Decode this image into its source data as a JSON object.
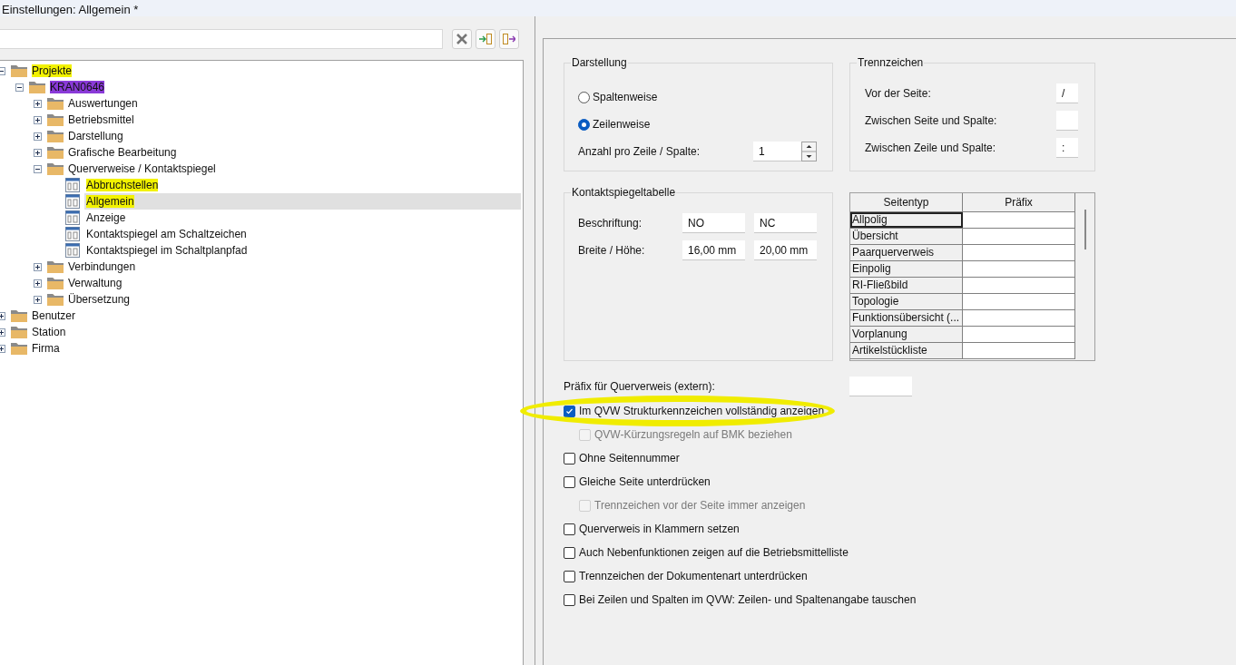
{
  "window": {
    "title": "Einstellungen: Allgemein *"
  },
  "toolbar": [
    {
      "kind": "clear"
    },
    {
      "kind": "import"
    },
    {
      "kind": "export"
    }
  ],
  "tree": [
    {
      "label": "Projekte",
      "kind": "folder",
      "expanded": true,
      "selected": false,
      "highlighted": true,
      "children": [
        {
          "label": "KRAN0646",
          "kind": "folder",
          "expanded": true,
          "selected": false,
          "scribbled": true,
          "children": [
            {
              "label": "Auswertungen",
              "kind": "folder",
              "expanded": false,
              "selected": false
            },
            {
              "label": "Betriebsmittel",
              "kind": "folder",
              "expanded": false,
              "selected": false
            },
            {
              "label": "Darstellung",
              "kind": "folder",
              "expanded": false,
              "selected": false
            },
            {
              "label": "Grafische Bearbeitung",
              "kind": "folder",
              "expanded": false,
              "selected": false
            },
            {
              "label": "Querverweise / Kontaktspiegel",
              "kind": "folder",
              "expanded": true,
              "selected": false,
              "children": [
                {
                  "label": "Abbruchstellen",
                  "kind": "page",
                  "selected": false,
                  "highlighted": true
                },
                {
                  "label": "Allgemein",
                  "kind": "page",
                  "selected": true,
                  "highlighted": true
                },
                {
                  "label": "Anzeige",
                  "kind": "page",
                  "selected": false
                },
                {
                  "label": "Kontaktspiegel am Schaltzeichen",
                  "kind": "page",
                  "selected": false
                },
                {
                  "label": "Kontaktspiegel im Schaltplanpfad",
                  "kind": "page",
                  "selected": false
                }
              ]
            },
            {
              "label": "Verbindungen",
              "kind": "folder",
              "expanded": false,
              "selected": false
            },
            {
              "label": "Verwaltung",
              "kind": "folder",
              "expanded": false,
              "selected": false
            },
            {
              "label": "Übersetzung",
              "kind": "folder",
              "expanded": false,
              "selected": false
            }
          ]
        }
      ]
    },
    {
      "label": "Benutzer",
      "kind": "folder",
      "expanded": false,
      "selected": false
    },
    {
      "label": "Station",
      "kind": "folder",
      "expanded": false,
      "selected": false
    },
    {
      "label": "Firma",
      "kind": "folder",
      "expanded": false,
      "selected": false
    }
  ],
  "darstellung": {
    "title": "Darstellung",
    "options": [
      {
        "label": "Spaltenweise",
        "selected": false
      },
      {
        "label": "Zeilenweise",
        "selected": true
      }
    ],
    "count_label": "Anzahl pro Zeile / Spalte:",
    "count_value": "1"
  },
  "trennzeichen": {
    "title": "Trennzeichen",
    "fields": [
      {
        "label": "Vor der Seite:",
        "value": "/"
      },
      {
        "label": "Zwischen Seite und Spalte:"
      },
      {
        "label": "Zwischen Zeile und Spalte:",
        "value": ":"
      }
    ]
  },
  "kontaktspiegeltabelle": {
    "title": "Kontaktspiegeltabelle",
    "rows": [
      {
        "label": "Beschriftung:",
        "values": [
          "NO",
          "NC"
        ]
      },
      {
        "label": "Breite / Höhe:",
        "values": [
          "16,00 mm",
          "20,00 mm"
        ]
      }
    ]
  },
  "table": {
    "columns": [
      "Seitentyp",
      "Präfix"
    ],
    "rows": [
      {
        "name": "Allpolig",
        "selected": true
      },
      {
        "name": "Übersicht",
        "selected": false
      },
      {
        "name": "Paarquerverweis",
        "selected": false
      },
      {
        "name": "Einpolig",
        "selected": false
      },
      {
        "name": "RI-Fließbild",
        "selected": false
      },
      {
        "name": "Topologie",
        "selected": false
      },
      {
        "name": "Funktionsübersicht (...",
        "selected": false
      },
      {
        "name": "Vorplanung",
        "selected": false
      },
      {
        "name": "Artikelstückliste",
        "selected": false
      }
    ]
  },
  "prefix_extern": {
    "label": "Präfix für Querverweis (extern):"
  },
  "checkboxes": [
    {
      "label": "Im QVW Strukturkennzeichen vollständig anzeigen",
      "checked": true,
      "disabled": false,
      "circled": true,
      "children": [
        {
          "label": "QVW-Kürzungsregeln auf BMK beziehen",
          "checked": false,
          "disabled": true
        }
      ]
    },
    {
      "label": "Ohne Seitennummer",
      "checked": false,
      "disabled": false
    },
    {
      "label": "Gleiche Seite unterdrücken",
      "checked": false,
      "disabled": false,
      "children": [
        {
          "label": "Trennzeichen vor der Seite immer anzeigen",
          "checked": false,
          "disabled": true
        }
      ]
    },
    {
      "label": "Querverweis in Klammern setzen",
      "checked": false,
      "disabled": false
    },
    {
      "label": "Auch Nebenfunktionen zeigen auf die Betriebsmittelliste",
      "checked": false,
      "disabled": false
    },
    {
      "label": "Trennzeichen der Dokumentenart unterdrücken",
      "checked": false,
      "disabled": false
    },
    {
      "label": "Bei Zeilen und Spalten im QVW: Zeilen- und Spaltenangabe tauschen",
      "checked": false,
      "disabled": false
    }
  ]
}
